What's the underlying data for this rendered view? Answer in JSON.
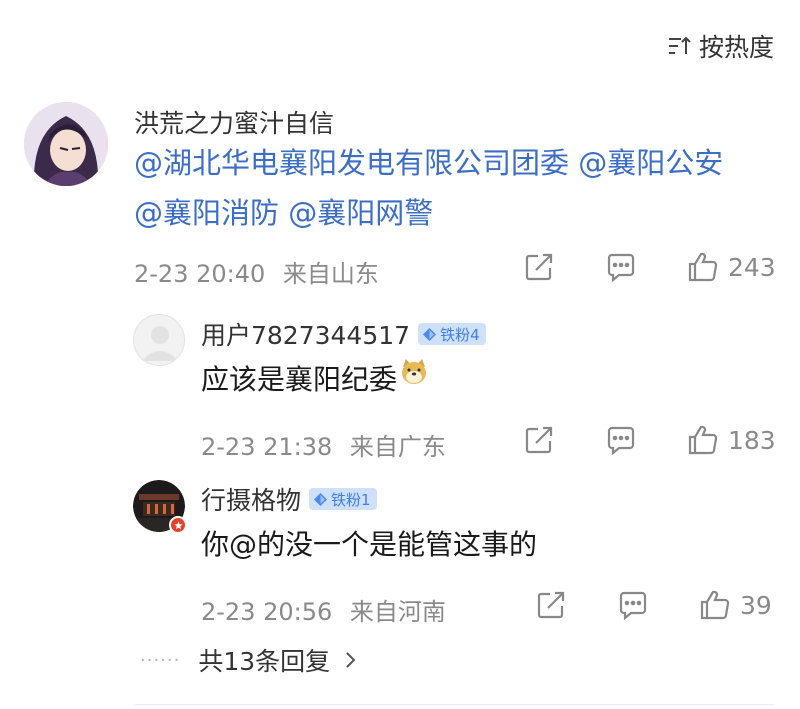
{
  "sort": {
    "label": "按热度"
  },
  "comment": {
    "user": "洪荒之力蜜汁自信",
    "line1": [
      "@湖北华电襄阳发电有限公司团委",
      "@襄阳公安"
    ],
    "line2": [
      "@襄阳消防",
      "@襄阳网警"
    ],
    "time": "2-23 20:40",
    "location": "来自山东",
    "likes": "243"
  },
  "replies": [
    {
      "user": "用户7827344517",
      "badge": "铁粉4",
      "text": "应该是襄阳纪委",
      "time": "2-23 21:38",
      "location": "来自广东",
      "likes": "183"
    },
    {
      "user": "行摄格物",
      "badge": "铁粉1",
      "text": "你@的没一个是能管这事的",
      "time": "2-23 20:56",
      "location": "来自河南",
      "likes": "39"
    }
  ],
  "more": {
    "dots": "······",
    "label": "共13条回复"
  },
  "icons": {
    "sort": "sort-icon",
    "share": "share-icon",
    "comment": "comment-icon",
    "like": "thumbs-up-icon",
    "badge": "diamond-icon",
    "emoji": "doge-emoji-icon",
    "chevron": "chevron-right-icon"
  },
  "colors": {
    "mention": "#3d6ec6",
    "badge_bg": "#cfe0fb",
    "badge_text": "#3f7fe6",
    "meta": "#8a8a8a"
  }
}
